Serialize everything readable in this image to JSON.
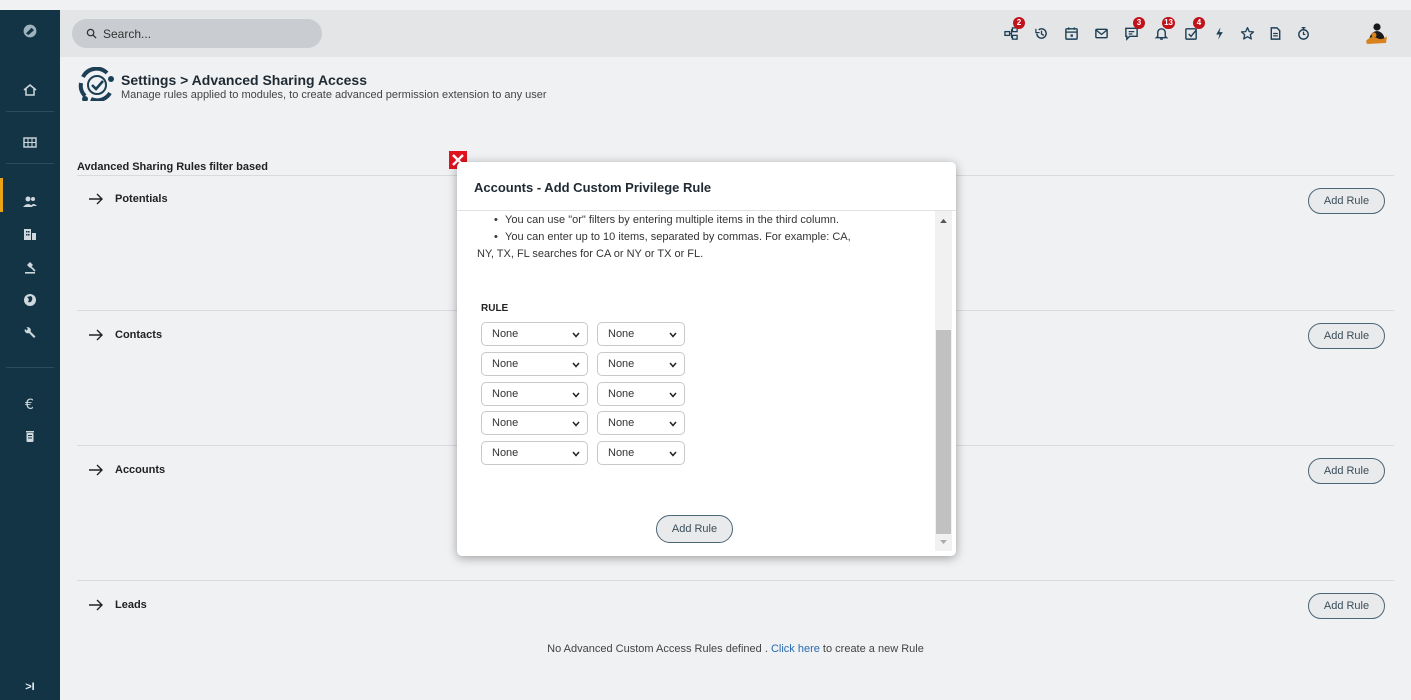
{
  "colors": {
    "sidebar": "#123445",
    "topbar": "#e4e5e7",
    "accent": "#e8a317",
    "badge": "#c0121a",
    "close": "#e0141e",
    "link": "#2a6ab0"
  },
  "topbar": {
    "search_placeholder": "Search...",
    "icons": [
      {
        "name": "org-chart-icon",
        "badge": "2"
      },
      {
        "name": "history-icon",
        "badge": ""
      },
      {
        "name": "calendar-icon",
        "badge": ""
      },
      {
        "name": "mail-icon",
        "badge": ""
      },
      {
        "name": "chat-icon",
        "badge": "3"
      },
      {
        "name": "bell-icon",
        "badge": "13"
      },
      {
        "name": "tasks-icon",
        "badge": "4"
      },
      {
        "name": "lightning-icon",
        "badge": ""
      },
      {
        "name": "star-icon",
        "badge": ""
      },
      {
        "name": "document-icon",
        "badge": ""
      },
      {
        "name": "timer-icon",
        "badge": ""
      }
    ]
  },
  "sidebar": {
    "icons": [
      "logo-icon",
      "home-icon",
      "apps-icon",
      "users-icon",
      "buildings-icon",
      "gavel-icon",
      "globe-icon",
      "wrench-icon",
      "euro-icon",
      "trash-icon"
    ],
    "toggle": ">I"
  },
  "header": {
    "title": "Settings > Advanced Sharing Access",
    "subtitle": "Manage rules applied to modules, to create advanced permission extension to any user"
  },
  "section_label": "Avdanced Sharing Rules filter based",
  "modules": [
    {
      "name": "Potentials",
      "button": "Add Rule"
    },
    {
      "name": "Contacts",
      "button": "Add Rule"
    },
    {
      "name": "Accounts",
      "button": "Add Rule"
    },
    {
      "name": "Leads",
      "button": "Add Rule"
    }
  ],
  "footer": {
    "before": "No Advanced Custom Access Rules defined . ",
    "link": "Click here",
    "after": " to create a new Rule"
  },
  "modal": {
    "title": "Accounts - Add Custom Privilege Rule",
    "notes": {
      "line1": "You can use \"or\" filters by entering multiple items in the third column.",
      "line2": "You can enter up to 10 items, separated by commas. For example: CA,",
      "line3": "NY, TX, FL searches for CA or NY or TX or FL."
    },
    "rule_label": "RULE",
    "rules": [
      {
        "field": "None",
        "operator": "None"
      },
      {
        "field": "None",
        "operator": "None"
      },
      {
        "field": "None",
        "operator": "None"
      },
      {
        "field": "None",
        "operator": "None"
      },
      {
        "field": "None",
        "operator": "None"
      }
    ],
    "add_button": "Add Rule"
  }
}
